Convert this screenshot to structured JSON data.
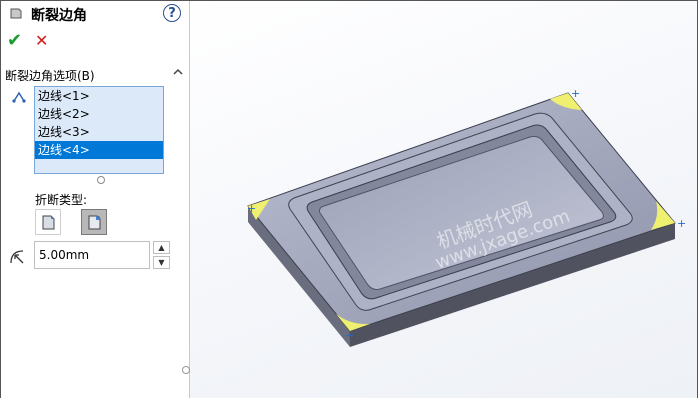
{
  "panel": {
    "title": "断裂边角",
    "help_label": "?",
    "ok_label": "✔",
    "cancel_label": "✕",
    "section_title": "断裂边角选项(B)",
    "edges": [
      "边线<1>",
      "边线<2>",
      "边线<3>",
      "边线<4>"
    ],
    "selected_edge_index": 3,
    "break_type_label": "折断类型:",
    "distance_value": "5.00mm"
  },
  "viewport": {
    "watermark_line1": "机械时代网",
    "watermark_line2": "www.jxage.com",
    "highlight_color": "#f0f070"
  },
  "icons": {
    "title": "break-corner-icon",
    "edge_selection": "edge-selection-icon",
    "chamfer": "chamfer-type-icon",
    "fillet": "fillet-type-icon",
    "radius": "radius-icon"
  }
}
